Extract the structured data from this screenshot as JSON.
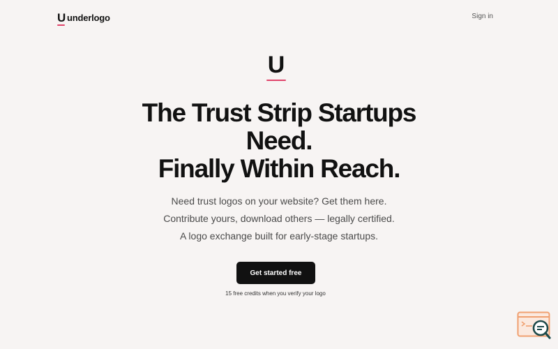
{
  "nav": {
    "brand_mark": "U",
    "brand_name": "underlogo",
    "signin_label": "Sign in"
  },
  "hero": {
    "mark": "U",
    "headline_lines": [
      "The Trust Strip Startups",
      "Need.",
      "Finally Within Reach."
    ],
    "subtitle_lines": [
      "Need trust logos on your website? Get them here.",
      "Contribute yours, download others — legally certified.",
      "A logo exchange built for early-stage startups."
    ],
    "cta_label": "Get started free",
    "note": "15 free credits when you verify your logo"
  },
  "colors": {
    "background": "#f7f4f3",
    "text": "#111111",
    "accent": "#e0436a",
    "widget_accent": "#f0a070",
    "widget_dark": "#1d4a4a"
  },
  "icons": {
    "feedback_widget": "browser-window-magnifier-icon"
  }
}
